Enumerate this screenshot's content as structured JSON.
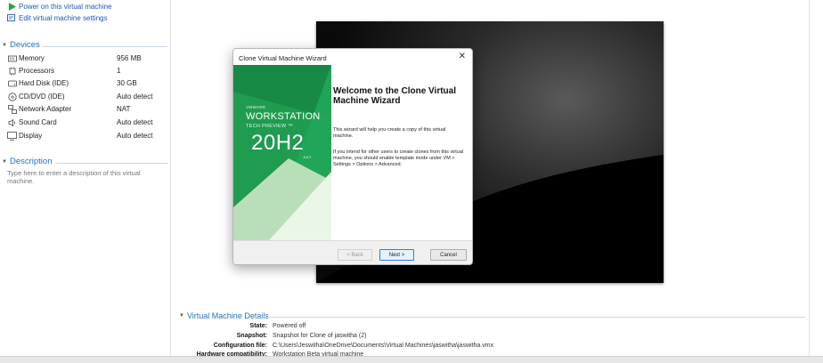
{
  "commands": [
    {
      "label": "Power on this virtual machine",
      "icon": "play-icon"
    },
    {
      "label": "Edit virtual machine settings",
      "icon": "settings-icon"
    }
  ],
  "devices": {
    "title": "Devices",
    "items": [
      {
        "name": "Memory",
        "value": "956 MB",
        "icon": "memory-icon"
      },
      {
        "name": "Processors",
        "value": "1",
        "icon": "processor-icon"
      },
      {
        "name": "Hard Disk (IDE)",
        "value": "30 GB",
        "icon": "hard-disk-icon"
      },
      {
        "name": "CD/DVD (IDE)",
        "value": "Auto detect",
        "icon": "cd-dvd-icon"
      },
      {
        "name": "Network Adapter",
        "value": "NAT",
        "icon": "network-adapter-icon"
      },
      {
        "name": "Sound Card",
        "value": "Auto detect",
        "icon": "sound-card-icon"
      },
      {
        "name": "Display",
        "value": "Auto detect",
        "icon": "display-icon"
      }
    ]
  },
  "description": {
    "title": "Description",
    "placeholder": "Type here to enter a description of this virtual machine."
  },
  "dialog": {
    "title": "Clone Virtual Machine Wizard",
    "close": "✕",
    "banner": {
      "vendor": "VMWARE",
      "product": "WORKSTATION",
      "edition": "TECH PREVIEW ™",
      "version": "20H2",
      "month": "JULY"
    },
    "heading": "Welcome to the Clone Virtual Machine Wizard",
    "paragraph1": "This wizard will help you create a copy of this virtual machine.",
    "paragraph2": "If you intend for other users to create clones from this virtual machine, you should enable template mode under VM > Settings > Options > Advanced.",
    "buttons": {
      "back": "< Back",
      "next": "Next >",
      "cancel": "Cancel"
    }
  },
  "details": {
    "title": "Virtual Machine Details",
    "rows": [
      {
        "key": "State:",
        "value": "Powered off"
      },
      {
        "key": "Snapshot:",
        "value": "Snapshot for Clone of jaswitha (2)"
      },
      {
        "key": "Configuration file:",
        "value": "C:\\Users\\Jeswitha\\OneDrive\\Documents\\Virtual Machines\\jaswitha\\jaswitha.vmx"
      },
      {
        "key": "Hardware compatibility:",
        "value": "Workstation Beta virtual machine"
      }
    ]
  },
  "colors": {
    "accent": "#2a6ebd",
    "banner_green": "#1e9a4f",
    "link_blue": "#1f57b8"
  }
}
